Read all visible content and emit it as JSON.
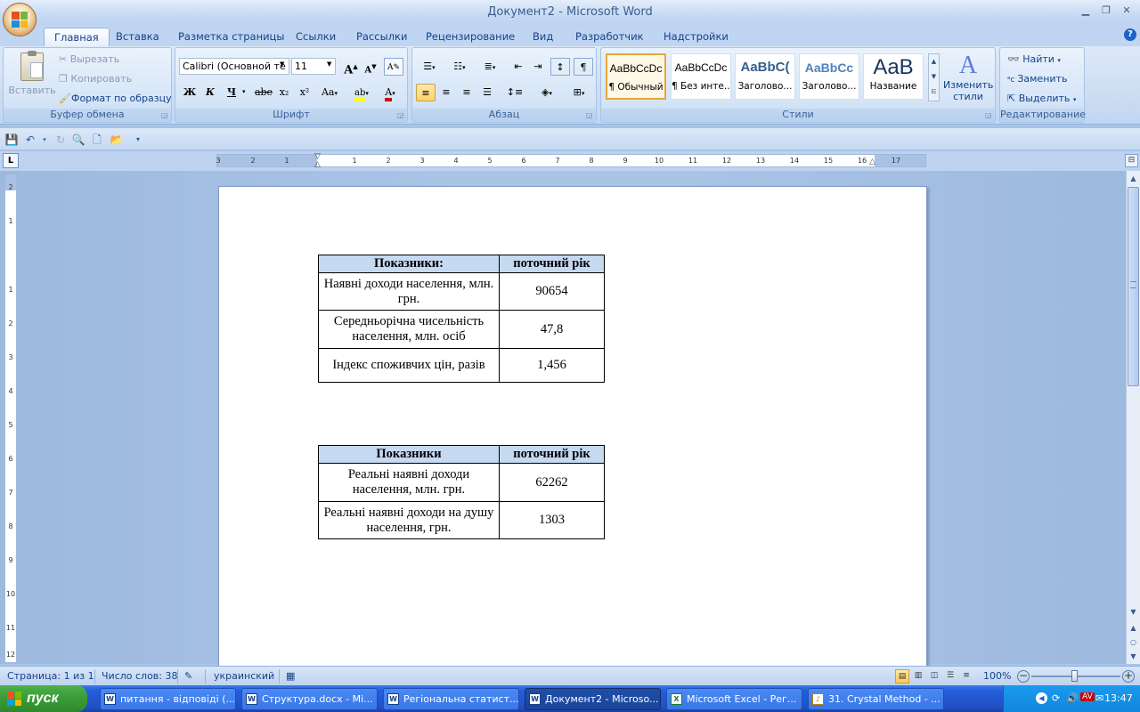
{
  "window": {
    "title": "Документ2 - Microsoft Word"
  },
  "tabs": [
    "Главная",
    "Вставка",
    "Разметка страницы",
    "Ссылки",
    "Рассылки",
    "Рецензирование",
    "Вид",
    "Разработчик",
    "Надстройки"
  ],
  "clipboard": {
    "paste": "Вставить",
    "cut": "Вырезать",
    "copy": "Копировать",
    "format_painter": "Формат по образцу",
    "label": "Буфер обмена"
  },
  "font": {
    "name": "Calibri (Основной те",
    "size": "11",
    "label": "Шрифт",
    "bold": "Ж",
    "italic": "К",
    "underline": "Ч",
    "strike": "abe",
    "sub": "x₂",
    "sup": "x²",
    "case": "Aa",
    "grow": "A",
    "shrink": "A"
  },
  "paragraph": {
    "label": "Абзац"
  },
  "styles": {
    "items": [
      {
        "preview": "AaBbCcDc",
        "name": "¶ Обычный"
      },
      {
        "preview": "AaBbCcDc",
        "name": "¶ Без инте..."
      },
      {
        "preview": "AaBbC(",
        "name": "Заголово..."
      },
      {
        "preview": "AaBbCc",
        "name": "Заголово..."
      },
      {
        "preview": "AaB",
        "name": "Название"
      }
    ],
    "change": "Изменить стили",
    "label": "Стили"
  },
  "editing": {
    "find": "Найти",
    "replace": "Заменить",
    "select": "Выделить",
    "label": "Редактирование"
  },
  "ruler_h": [
    "3",
    "2",
    "1",
    "1",
    "2",
    "3",
    "4",
    "5",
    "6",
    "7",
    "8",
    "9",
    "10",
    "11",
    "12",
    "13",
    "14",
    "15",
    "16",
    "17"
  ],
  "ruler_v": [
    "2",
    "1",
    "1",
    "2",
    "3",
    "4",
    "5",
    "6",
    "7",
    "8",
    "9",
    "10",
    "11",
    "12"
  ],
  "table1": {
    "headers": [
      "Показники:",
      "поточний рік"
    ],
    "rows": [
      [
        "Наявні доходи населення, млн. грн.",
        "90654"
      ],
      [
        "Середньорічна чисельність населення, млн. осіб",
        "47,8"
      ],
      [
        "Індекс споживчих цін, разів",
        "1,456"
      ]
    ]
  },
  "table2": {
    "headers": [
      "Показники",
      "поточний рік"
    ],
    "rows": [
      [
        "Реальні наявні доходи населення, млн. грн.",
        "62262"
      ],
      [
        "Реальні наявні доходи на душу населення, грн.",
        "1303"
      ]
    ]
  },
  "status": {
    "page": "Страница: 1 из 1",
    "words": "Число слов: 38",
    "lang": "украинский",
    "zoom": "100%"
  },
  "taskbar": {
    "start": "пуск",
    "tasks": [
      "питання - відповіді (...",
      "Структура.docx - Mi...",
      "Регіональна статист...",
      "Документ2 - Microso...",
      "Microsoft Excel - Рег...",
      "31. Crystal Method - ..."
    ],
    "lang": "UK",
    "time": "13:47"
  },
  "colors": {
    "accent": "#15428b",
    "ribbon": "#d4e4f7",
    "table_header": "#c5d9f1",
    "taskbar": "#245edb",
    "start": "#3a9a38"
  }
}
